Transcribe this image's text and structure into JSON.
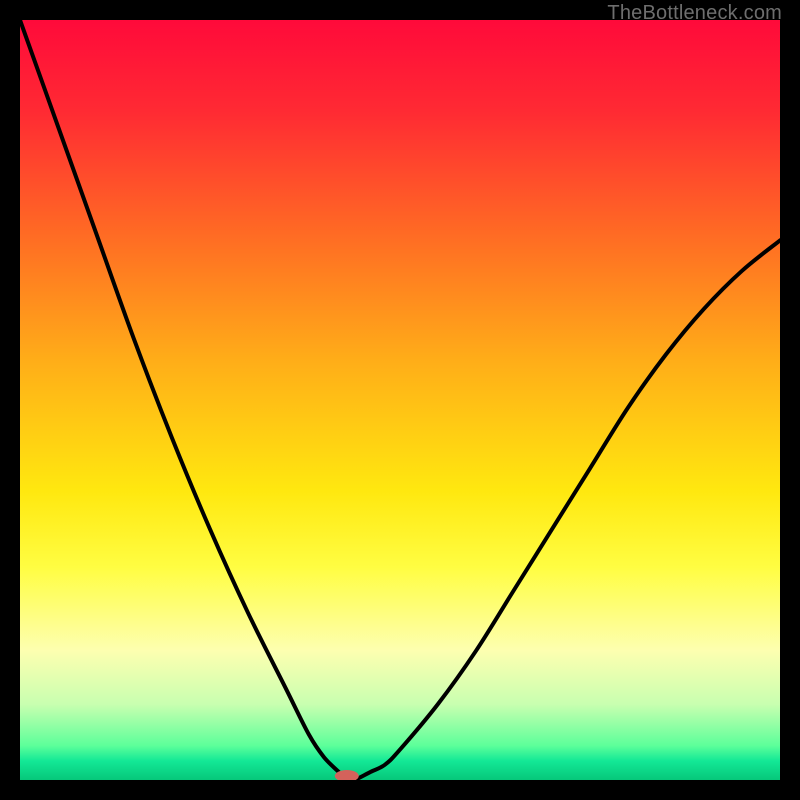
{
  "watermark": "TheBottleneck.com",
  "chart_data": {
    "type": "line",
    "title": "",
    "xlabel": "",
    "ylabel": "",
    "xlim": [
      0,
      100
    ],
    "ylim": [
      0,
      100
    ],
    "grid": false,
    "x": [
      0,
      5,
      10,
      15,
      20,
      25,
      30,
      35,
      38,
      40,
      42,
      43,
      44,
      46,
      48,
      50,
      55,
      60,
      65,
      70,
      75,
      80,
      85,
      90,
      95,
      100
    ],
    "values": [
      100,
      86,
      72,
      58,
      45,
      33,
      22,
      12,
      6,
      3,
      1,
      0,
      0,
      1,
      2,
      4,
      10,
      17,
      25,
      33,
      41,
      49,
      56,
      62,
      67,
      71
    ],
    "optimum_x": 43,
    "gradient_stops": [
      {
        "offset": 0.0,
        "color": "#ff0a3a"
      },
      {
        "offset": 0.12,
        "color": "#ff2a33"
      },
      {
        "offset": 0.28,
        "color": "#ff6a24"
      },
      {
        "offset": 0.45,
        "color": "#ffae18"
      },
      {
        "offset": 0.62,
        "color": "#ffe80f"
      },
      {
        "offset": 0.72,
        "color": "#fffd42"
      },
      {
        "offset": 0.83,
        "color": "#fdffb0"
      },
      {
        "offset": 0.9,
        "color": "#c9ffb0"
      },
      {
        "offset": 0.955,
        "color": "#5cff9a"
      },
      {
        "offset": 0.975,
        "color": "#13e896"
      },
      {
        "offset": 1.0,
        "color": "#06c77a"
      }
    ],
    "marker": {
      "x": 43,
      "y": 0,
      "color": "#d4625b",
      "rx": 12,
      "ry": 6
    }
  }
}
